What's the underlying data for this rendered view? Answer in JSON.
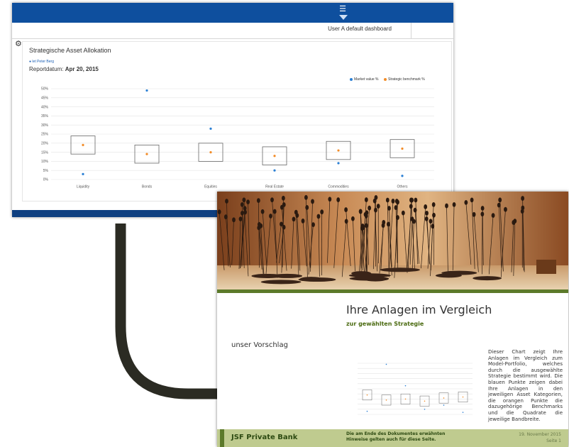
{
  "dashboard": {
    "tab_label": "User A default dashboard",
    "card_title": "Strategische Asset Allokation",
    "author": "let Peter Berg",
    "report_label": "Reportdatum:",
    "report_date": "Apr 20, 2015",
    "colors": {
      "header": "#0e4f9e",
      "market": "#2a7fd4",
      "benchmark": "#f28c28"
    }
  },
  "slide": {
    "heading": "Ihre Anlagen im Vergleich",
    "subheading": "zur gewählten Strategie",
    "left_label": "unser Vorschlag",
    "description": "Dieser Chart zeigt Ihre Anlagen im Vergleich zum Model-Portfolio, welches durch die ausgewählte Strategie bestimmt wird. Die blauen Punkte zeigen dabei Ihre Anlagen in den jeweiligen Asset Kategorien, die orangen Punkte die dazugehörige Benchmarks und die Quadrate die jeweilige Bandbreite.",
    "brand": "JSF Private Bank",
    "notice": "Die am Ende des Dokumentes erwähnten Hinweise gelten auch für diese Seite.",
    "date": "19. November 2015",
    "page": "Seite 1",
    "colors": {
      "accent": "#5c7a2a",
      "footer": "#bfcb8f"
    }
  },
  "chart_data": {
    "type": "scatter",
    "title": "",
    "categories": [
      "Liquidity",
      "Bonds",
      "Equities",
      "Real Estate",
      "Commodities",
      "Others"
    ],
    "ylim": [
      0,
      50
    ],
    "yticks": [
      "0%",
      "5%",
      "10%",
      "15%",
      "20%",
      "25%",
      "30%",
      "35%",
      "40%",
      "45%",
      "50%"
    ],
    "series": [
      {
        "name": "Market value %",
        "values": [
          3,
          49,
          28,
          5,
          9,
          2
        ]
      },
      {
        "name": "Strategic benchmark %",
        "values": [
          19,
          14,
          15,
          13,
          16,
          17
        ]
      }
    ],
    "bands": [
      {
        "low": 14,
        "high": 24
      },
      {
        "low": 9,
        "high": 19
      },
      {
        "low": 10,
        "high": 20
      },
      {
        "low": 8,
        "high": 18
      },
      {
        "low": 11,
        "high": 21
      },
      {
        "low": 12,
        "high": 22
      }
    ],
    "legend_position": "top-right",
    "grid": true
  }
}
